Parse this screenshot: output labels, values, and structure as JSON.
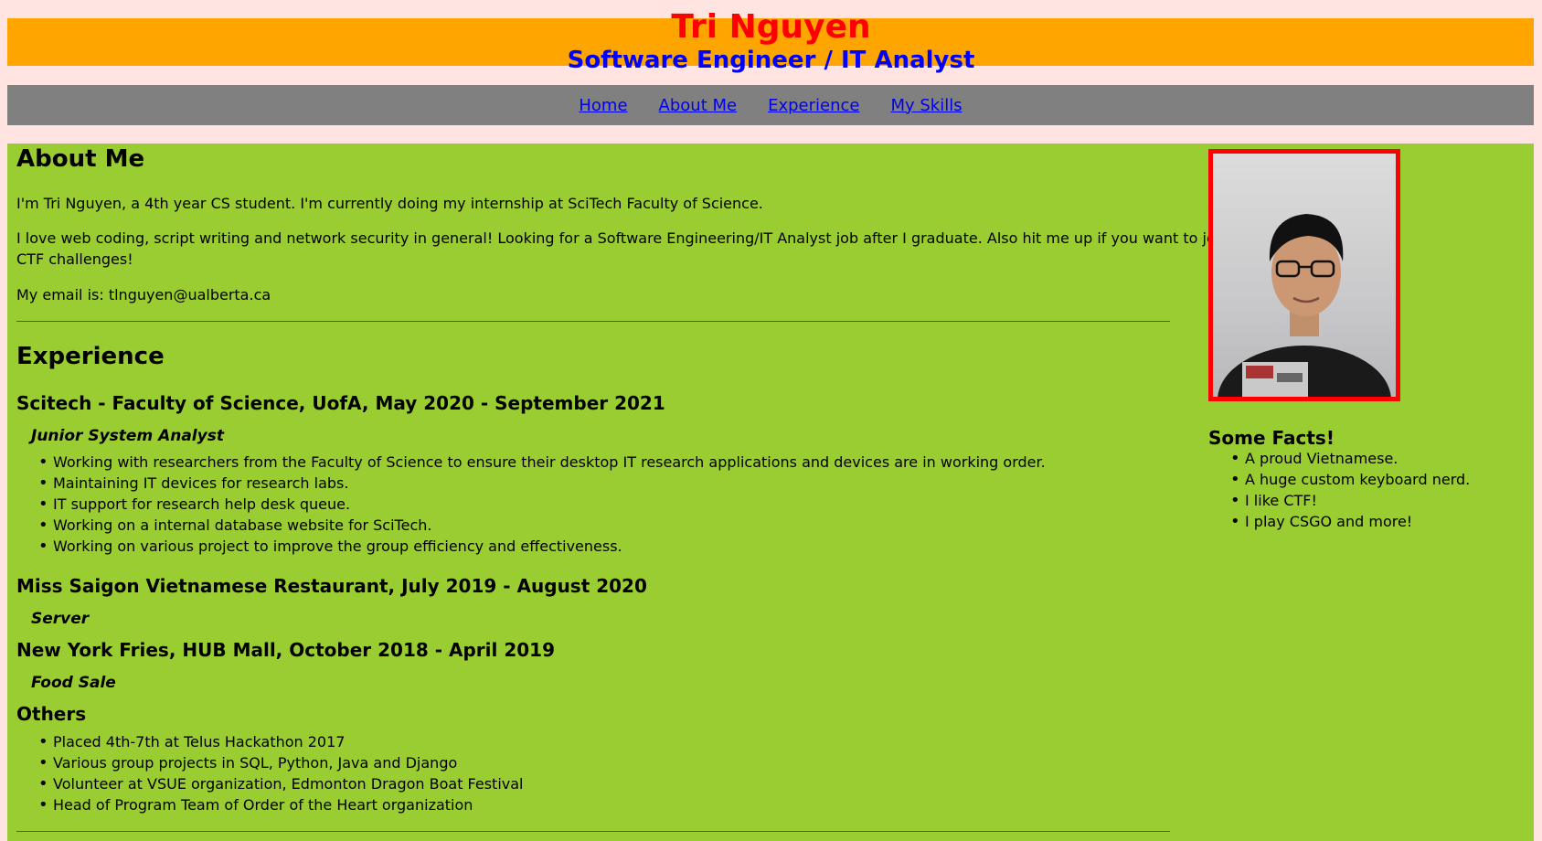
{
  "header": {
    "name": "Tri Nguyen",
    "role": "Software Engineer / IT Analyst",
    "colors": {
      "banner": "#ffa500",
      "name": "#ff0000",
      "role": "#0000ff"
    }
  },
  "nav": {
    "items": [
      {
        "label": "Home"
      },
      {
        "label": "About Me"
      },
      {
        "label": "Experience"
      },
      {
        "label": "My Skills"
      }
    ]
  },
  "about": {
    "heading": "About Me",
    "para1": "I'm Tri Nguyen, a 4th year CS student. I'm currently doing my internship at SciTech Faculty of Science.",
    "para2_line1": "I love web coding, script writing and network security in general! Looking for a Software Engineering/IT Analyst job after I graduate. Also hit me up if you want to join me cra",
    "para2_line2": "CTF challenges!",
    "email": "My email is: tlnguyen@ualberta.ca"
  },
  "experience": {
    "heading": "Experience",
    "jobs": [
      {
        "company": "Scitech - Faculty of Science, UofA, May 2020 - September 2021",
        "title": "Junior System Analyst",
        "duties": [
          "Working with researchers from the Faculty of Science to ensure their desktop IT research applications and devices are in working order.",
          "Maintaining IT devices for research labs.",
          "IT support for research help desk queue.",
          "Working on a internal database website for SciTech.",
          "Working on various project to improve the group efficiency and effectiveness."
        ]
      },
      {
        "company": "Miss Saigon Vietnamese Restaurant, July 2019 - August 2020",
        "title": "Server"
      },
      {
        "company": "New York Fries, HUB Mall, October 2018 - April 2019",
        "title": "Food Sale"
      }
    ],
    "others_heading": "Others",
    "others": [
      "Placed 4th-7th at Telus Hackathon 2017",
      "Various group projects in SQL, Python, Java and Django",
      "Volunteer at VSUE organization, Edmonton Dragon Boat Festival",
      "Head of Program Team of Order of the Heart organization"
    ]
  },
  "facts": {
    "heading": "Some Facts!",
    "items": [
      "A proud Vietnamese.",
      "A huge custom keyboard nerd.",
      "I like CTF!",
      "I play CSGO and more!"
    ]
  },
  "photo": {
    "icon": "profile-photo"
  }
}
